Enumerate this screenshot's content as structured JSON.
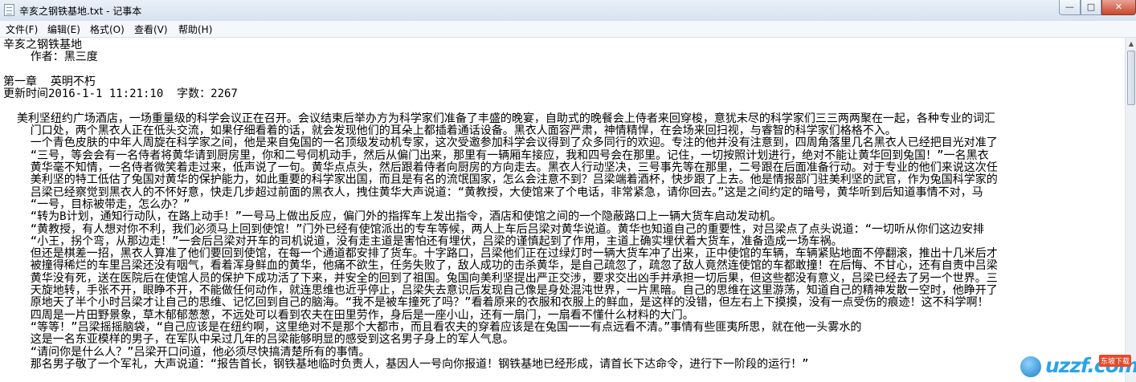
{
  "window": {
    "title": "辛亥之钢铁基地.txt - 记事本",
    "minimize_glyph": "—",
    "maximize_glyph": "□",
    "close_glyph": "✕",
    "icon": "notepad-icon"
  },
  "menu": [
    {
      "label": "文件(F)"
    },
    {
      "label": "编辑(E)"
    },
    {
      "label": "格式(O)"
    },
    {
      "label": "查看(V)"
    },
    {
      "label": "帮助(H)"
    }
  ],
  "document": {
    "lines": [
      "辛亥之钢铁基地",
      "    作者：黑三度",
      "",
      "第一章  英明不朽",
      "更新时间2016-1-1 11:21:10  字数：2267",
      "",
      "  美利坚纽约广场酒店，一场重量级的科学会议正在召开。会议结束后举办方为科学家们准备了丰盛的晚宴，自助式的晚餐会上侍者来回穿梭，意犹未尽的科学家们三三两两聚在一起，各种专业的词汇",
      "    门口处，两个黑衣人正在低头交流，如果仔细看着的话，就会发现他们的耳朵上都插着通话设备。黑衣人面容严肃，神情精悍，在会场来回扫视，与睿智的科学家们格格不入。",
      "    一个青色皮肤的中年人周旋在科学家之间，他是来自兔国的一名顶级发动机专家，这次受邀参加科学会议得到了众多同行的欢迎。专注的他并没有注意到，四周角落里几名黑衣人已经把目光对准了",
      "    “三号，等会会有一名侍者将黄华请到厨房里，你和二号伺机动手，然后从偏门出来，那里有一辆厢车接应，我和四号会在那里。记住，一切按照计划进行，绝对不能让黄华回到兔国！”一名黑衣",
      "    黄华毫不知情，一名侍者微笑着走过来，低声说了一句。黄华点点头，然后跟着侍者向厨房的方向走去。黑衣人行动坚决，三号事先等在那里，二号跟在后面准备行动。对于专业的他们来说这次任",
      "    美利坚的特工低估了兔国对黄华的保护能力，如此重要的科学家出国，而且是有名的流氓国家，怎么会注意不到？吕梁端着酒杯，快步跟了上去。他是情报部门驻美利坚的武官，作为兔国科学家的",
      "    吕梁已经察觉到黑衣人的不怀好意，快走几步超过前面的黑衣人，拽住黄华大声说道：“黄教授，大使馆来了个电话，非常紧急，请你回去。”这是之间约定的暗号，黄华听到后知道事情不对，马",
      "    “一号，目标被带走，怎么办？”",
      "    “转为B计划，通知行动队，在路上动手！”一号马上做出反应，偏门外的指挥车上发出指令，酒店和使馆之间的一个隐蔽路口上一辆大货车启动发动机。",
      "    “黄教授，有人想对你不利，我们必须马上回到使馆！”门外已经有使馆派出的专车等候，两人上车后吕梁对黄华说道。黄华也知道自己的重要性，对吕梁点了点头说道：“一切听从你们这边安排",
      "    “小王，拐个弯，从那边走！”一会后吕梁对开车的司机说道，没有走主道是害怕还有埋伏，吕梁的谨慎起到了作用，主道上确实埋伏着大货车，准备造成一场车祸。",
      "    但还是棋差一招，黑衣人算准了他们要回到使馆，在每一个通道都安排了货车。十字路口，吕梁他们正在过绿灯时一辆大货车冲了出来，正中使馆的车辆，车辆紧贴地面不停翻滚，推出十几米后才",
      "    被撞得稀烂的车里吕梁还没有咽气，看着浑身鲜血的黄华，他痛不欲生，任务失败了，敌人成功的击杀黄华，是自己疏忽了，疏忽了敌人竟然连使馆的车都敢撞！在后悔、不甘心，还有自责中吕梁",
      "    黄华没有死，送在医院后在使馆人员的保护下成功活了下来，并安全的回到了祖国。兔国向美利坚提出严正交涉，要求交出凶手并承担一切后果，但这些都没有意义，吕梁已经去了另一个世界。三",
      "    天旋地转，手张不开，眼睁不开，不能做任何动作，就连思维也近乎停止，吕梁失去意识后发现自己像是身处混沌世界，一片黑暗。自己的思维在这里游荡，知道自己的精神发散一空时，他睁开了",
      "    原地天了半个小时吕梁才让自己的思维、记忆回到自己的脑海。“我不是被车撞死了吗？”看着原来的衣服和衣服上的鲜血，是这样的没错，但左右上下摸摸，没有一点受伤的痕迹！这不科学啊！",
      "    四周是一片田野景象，草木郁郁葱葱，不远处可以看到农夫在田里劳作，身后是一座小山，还有一扇门，一扇看不懂什么材料的大门。",
      "    “等等！”吕梁摇摇脑袋，“自己应该是在纽约啊，这里绝对不是那个大都市，而且看农夫的穿着应该是在兔国一一有点远看不清。”事情有些匪夷所思，就在他一头雾水的",
      "    这是一名东亚模样的男子，在军队中呆过几年的吕梁能够明显的感受到这名男子身上的军人气息。",
      "    “请问你是什么人？”吕梁开口问道，他必须尽快搞清楚所有的事情。",
      "    那名男子敬了一个军礼，大声说道：“报告首长，钢铁基地临时负责人，基因人一号向你报道！钢铁基地已经形成，请首长下达命令，进行下一阶段的运行！”"
    ]
  },
  "scrollbar": {
    "up_glyph": "▲"
  },
  "watermark": {
    "text": "uzzf.com",
    "sub": "东坡下载"
  }
}
